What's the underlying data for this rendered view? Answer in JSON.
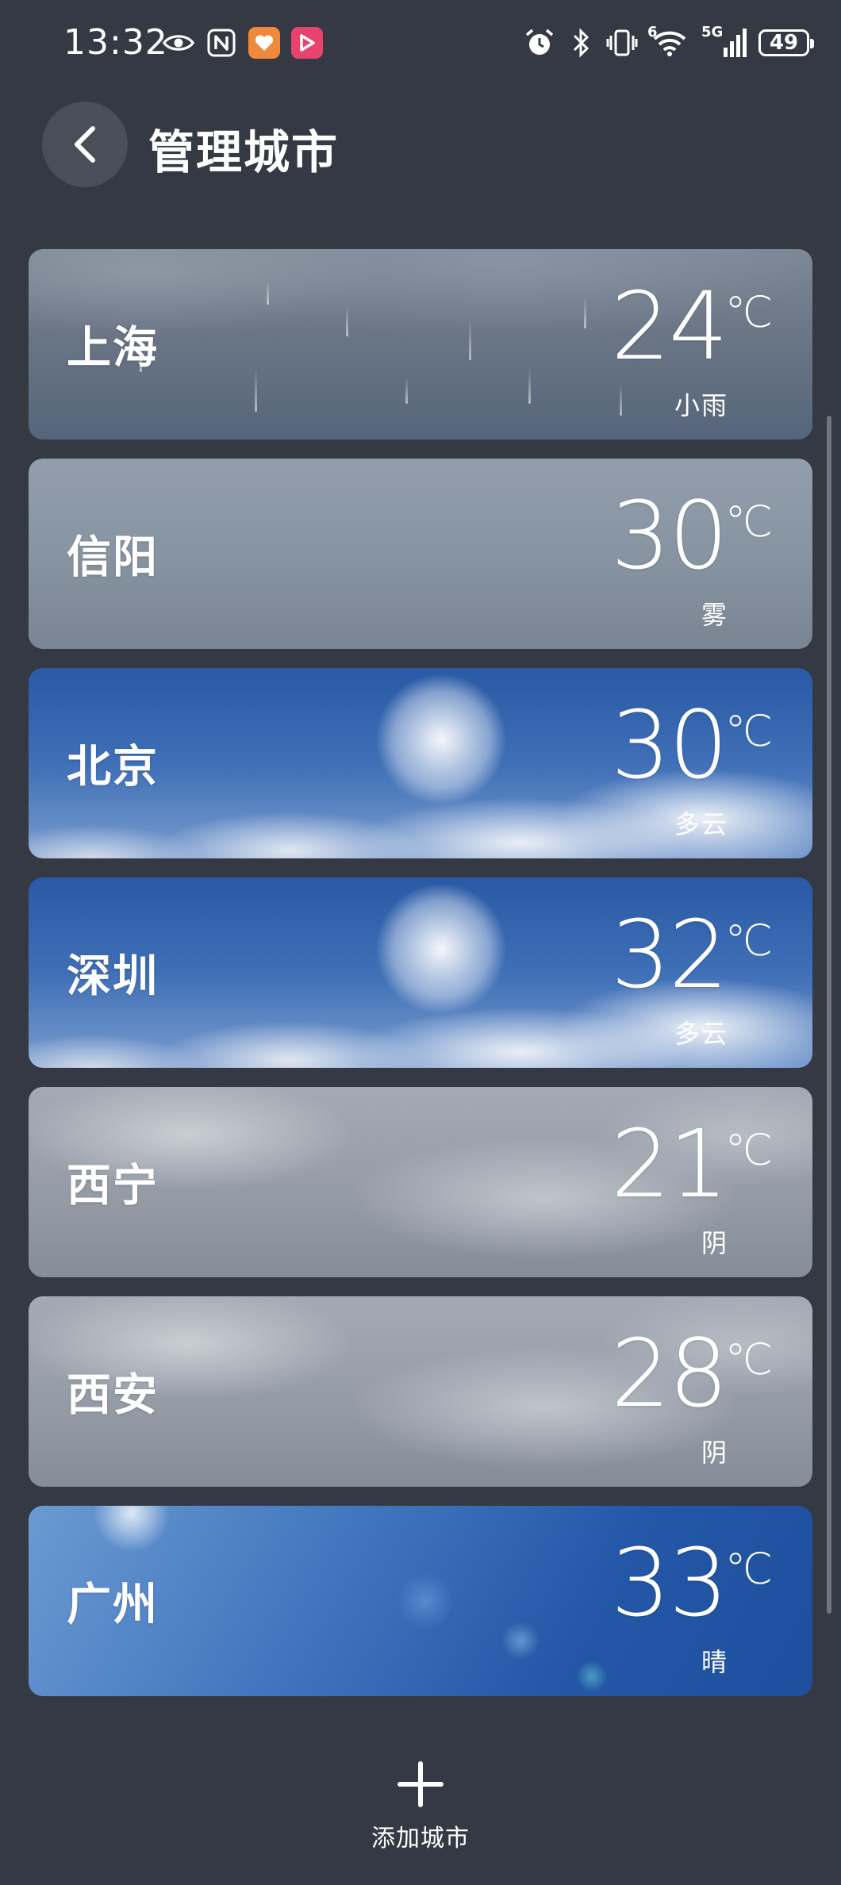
{
  "status_bar": {
    "time": "13:32",
    "battery": "49",
    "network_generation": "5G",
    "wifi_badge": "6",
    "icons": [
      "eye-icon",
      "nfc-icon",
      "heart-app-icon",
      "video-app-icon",
      "alarm-icon",
      "bluetooth-icon",
      "vibrate-icon",
      "wifi-icon",
      "signal-icon",
      "battery-icon"
    ]
  },
  "header": {
    "title": "管理城市",
    "back_icon": "chevron-left-icon"
  },
  "cities": [
    {
      "name": "上海",
      "temp": "24",
      "unit": "℃",
      "condition": "小雨"
    },
    {
      "name": "信阳",
      "temp": "30",
      "unit": "℃",
      "condition": "雾"
    },
    {
      "name": "北京",
      "temp": "30",
      "unit": "℃",
      "condition": "多云"
    },
    {
      "name": "深圳",
      "temp": "32",
      "unit": "℃",
      "condition": "多云"
    },
    {
      "name": "西宁",
      "temp": "21",
      "unit": "℃",
      "condition": "阴"
    },
    {
      "name": "西安",
      "temp": "28",
      "unit": "℃",
      "condition": "阴"
    },
    {
      "name": "广州",
      "temp": "33",
      "unit": "℃",
      "condition": "晴"
    }
  ],
  "add_city": {
    "label": "添加城市",
    "icon": "plus-icon"
  },
  "colors": {
    "background": "#353943",
    "text": "#ffffff"
  }
}
